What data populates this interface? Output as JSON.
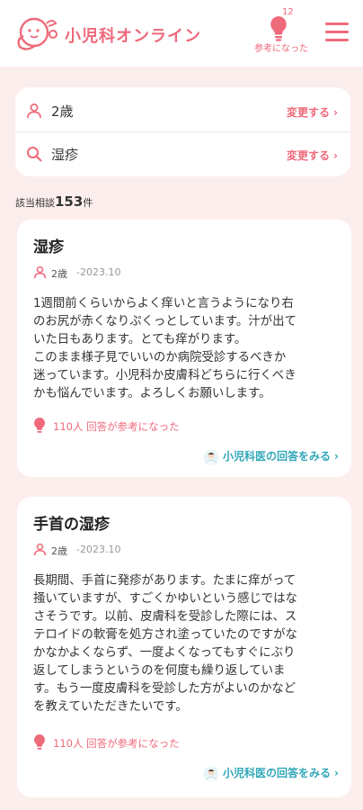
{
  "header": {
    "logo_text": "小児科オンライン",
    "helpful_count": "12",
    "helpful_label": "参考になった",
    "brand_color": "#ee6a7b"
  },
  "search": {
    "age": {
      "value": "2歳",
      "change_label": "変更する"
    },
    "keyword": {
      "value": "湿疹",
      "change_label": "変更する"
    }
  },
  "results": {
    "prefix": "該当相談",
    "count": "153",
    "suffix": "件"
  },
  "cards": [
    {
      "title": "湿疹",
      "age": "2歳",
      "date": "-2023.10",
      "body": "1週間前くらいからよく痒いと言うようになり右\nのお尻が赤くなりぷくっとしています。汁が出て\nいた日もあります。とても痒がります。\nこのまま様子見でいいのか病院受診するべきか\n迷っています。小児科か皮膚科どちらに行くべき\nかも悩んでいます。よろしくお願いします。",
      "helpful": "110人 回答が参考になった",
      "link": "小児科医の回答をみる"
    },
    {
      "title": "手首の湿疹",
      "age": "2歳",
      "date": "-2023.10",
      "body": "長期間、手首に発疹があります。たまに痒がって\n掻いていますが、すごくかゆいという感じではな\nさそうです。以前、皮膚科を受診した際には、ス\nテロイドの軟膏を処方され塗っていたのですがな\nかなかよくならず、一度よくなってもすぐにぶり\n返してしまうというのを何度も繰り返していま\nす。もう一度皮膚科を受診した方がよいのかなど\nを教えていただきたいです。",
      "helpful": "110人 回答が参考になった",
      "link": "小児科医の回答をみる"
    }
  ],
  "colors": {
    "accent": "#ee6a7b",
    "link": "#2fa7b8",
    "background": "#fdeeee"
  }
}
